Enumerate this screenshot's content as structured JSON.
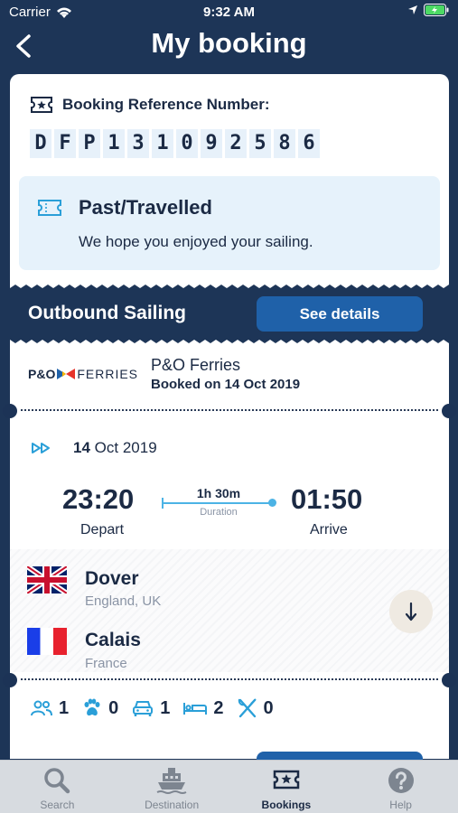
{
  "status_bar": {
    "carrier": "Carrier",
    "time": "9:32 AM"
  },
  "header": {
    "title": "My booking"
  },
  "booking": {
    "reference_label": "Booking Reference Number:",
    "reference_chars": [
      "D",
      "F",
      "P",
      "1",
      "3",
      "1",
      "0",
      "9",
      "2",
      "5",
      "8",
      "6"
    ],
    "status_title": "Past/Travelled",
    "status_text": "We hope you enjoyed your sailing."
  },
  "outbound": {
    "label": "Outbound Sailing",
    "details_button": "See details",
    "operator_logo_text": "P&O",
    "operator_logo_suffix": "FERRIES",
    "operator_name": "P&O Ferries",
    "booked_on": "Booked on 14 Oct 2019",
    "date_day": "14",
    "date_rest": "Oct 2019",
    "depart_time": "23:20",
    "depart_label": "Depart",
    "arrive_time": "01:50",
    "arrive_label": "Arrive",
    "duration": "1h 30m",
    "duration_label": "Duration",
    "from_port": "Dover",
    "from_country": "England, UK",
    "to_port": "Calais",
    "to_country": "France",
    "passengers": {
      "adults": "1",
      "pets": "0",
      "vehicles": "1",
      "cabins": "2",
      "meals": "0"
    }
  },
  "tabs": [
    {
      "label": "Search"
    },
    {
      "label": "Destination"
    },
    {
      "label": "Bookings"
    },
    {
      "label": "Help"
    }
  ],
  "colors": {
    "navy": "#1c3356",
    "accent": "#1f61a9",
    "light_blue": "#4cb3e5"
  }
}
